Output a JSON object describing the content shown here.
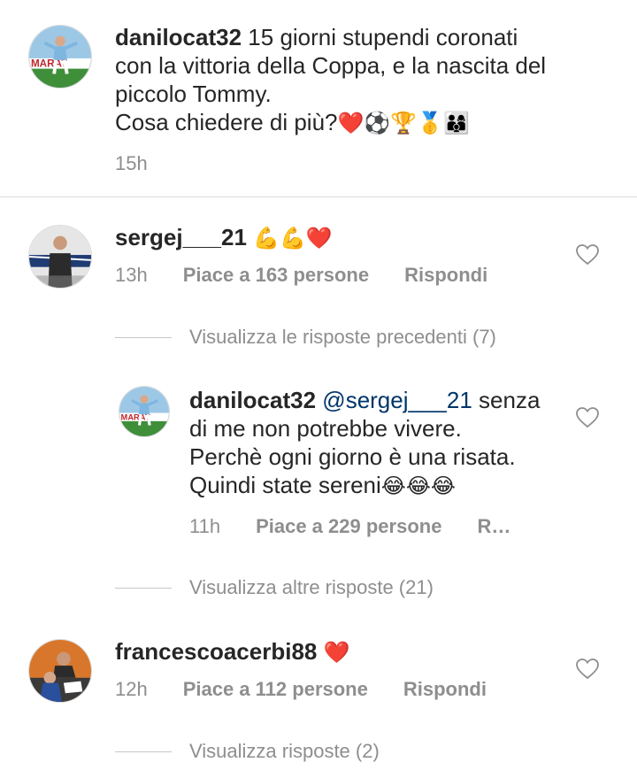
{
  "caption": {
    "username": "danilocat32",
    "text_line1": "15 giorni stupendi coronati",
    "text_line2": "con la vittoria della Coppa, e la nascita del",
    "text_line3": "piccolo Tommy.",
    "text_line4": "Cosa chiedere di più?",
    "emojis": "❤️⚽🏆🥇👨‍👩‍👦",
    "time": "15h"
  },
  "comments": [
    {
      "username": "sergej___21",
      "text": "💪💪❤️",
      "time": "13h",
      "likes": "Piace a 163 persone",
      "reply": "Rispondi",
      "thread": "Visualizza le risposte precedenti (7)",
      "replies": [
        {
          "username": "danilocat32",
          "mention": "@sergej___21",
          "text_line1": "senza",
          "text_line2": "di me non potrebbe vivere.",
          "text_line3": "Perchè ogni giorno è una risata.",
          "text_line4": "Quindi state sereni",
          "emojis": "😂😂😂",
          "time": "11h",
          "likes": "Piace a 229 persone",
          "reply": "R…"
        }
      ],
      "thread_more": "Visualizza altre risposte (21)"
    },
    {
      "username": "francescoacerbi88",
      "text": "❤️",
      "time": "12h",
      "likes": "Piace a 112 persone",
      "reply": "Rispondi",
      "thread": "Visualizza risposte (2)"
    }
  ],
  "icons": {
    "like": "heart-outline-icon"
  },
  "colors": {
    "text": "#262626",
    "secondary": "#8e8e8e",
    "mention": "#003569",
    "heart_red": "#ed4956"
  }
}
